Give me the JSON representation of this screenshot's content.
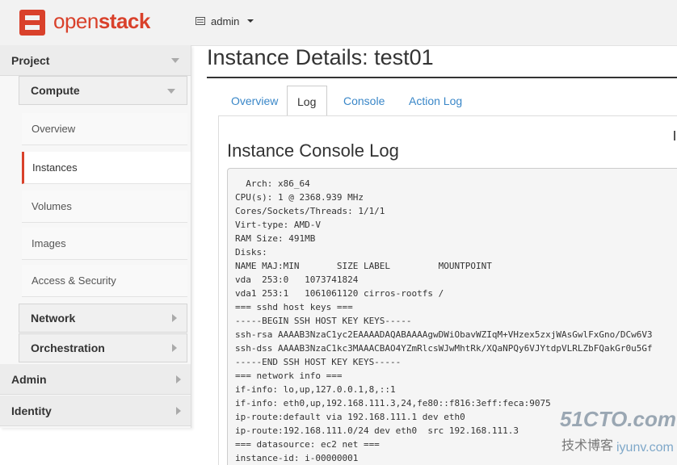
{
  "brand": {
    "prefix": "open",
    "suffix": "stack"
  },
  "header": {
    "project_label": "admin"
  },
  "sidebar": {
    "project": "Project",
    "compute": "Compute",
    "items": [
      "Overview",
      "Instances",
      "Volumes",
      "Images",
      "Access & Security"
    ],
    "network": "Network",
    "orchestration": "Orchestration",
    "admin": "Admin",
    "identity": "Identity"
  },
  "page": {
    "title": "Instance Details: test01",
    "tabs": [
      "Overview",
      "Log",
      "Console",
      "Action Log"
    ],
    "active_tab": "Log",
    "log_title": "Instance Console Log"
  },
  "log": {
    "lines": [
      "  Arch: x86_64",
      "CPU(s): 1 @ 2368.939 MHz",
      "Cores/Sockets/Threads: 1/1/1",
      "Virt-type: AMD-V",
      "RAM Size: 491MB",
      "Disks:",
      "NAME MAJ:MIN       SIZE LABEL         MOUNTPOINT",
      "vda  253:0   1073741824",
      "vda1 253:1   1061061120 cirros-rootfs /",
      "=== sshd host keys ===",
      "-----BEGIN SSH HOST KEY KEYS-----",
      "ssh-rsa AAAAB3NzaC1yc2EAAAADAQABAAAAgwDWiObavWZIqM+VHzex5zxjWAsGwlFxGno/DCw6V3",
      "ssh-dss AAAAB3NzaC1kc3MAAACBAO4YZmRlcsWJwMhtRk/XQaNPQy6VJYtdpVLRLZbFQakGr0u5Gf",
      "-----END SSH HOST KEY KEYS-----",
      "=== network info ===",
      "if-info: lo,up,127.0.0.1,8,::1",
      "if-info: eth0,up,192.168.111.3,24,fe80::f816:3eff:feca:9075",
      "ip-route:default via 192.168.111.1 dev eth0",
      "ip-route:192.168.111.0/24 dev eth0  src 192.168.111.3",
      "=== datasource: ec2 net ===",
      "instance-id: i-00000001"
    ]
  },
  "watermark": {
    "line1": "51CTO.com",
    "line2": "技术博客",
    "line3": "iyunv.com"
  },
  "colors": {
    "brand": "#d9412b",
    "link": "#3a87c8"
  }
}
